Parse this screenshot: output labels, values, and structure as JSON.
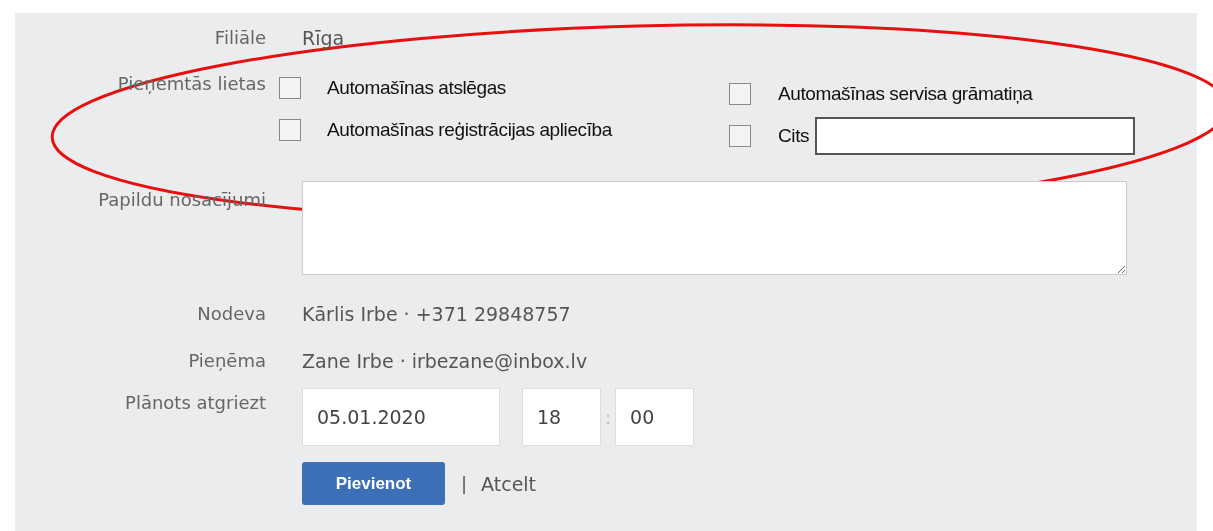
{
  "branch": {
    "label": "Filiāle",
    "value": "Rīga"
  },
  "accepted_items": {
    "label": "Pieņemtās lietas",
    "options": [
      {
        "kind": "checkbox",
        "label": "Automašīnas atslēgas",
        "checked": false
      },
      {
        "kind": "checkbox",
        "label": "Automašīnas servisa grāmatiņa",
        "checked": false
      },
      {
        "kind": "checkbox",
        "label": "Automašīnas reģistrācijas apliecība",
        "checked": false
      },
      {
        "kind": "checkbox-with-field",
        "label": "Cits",
        "checked": false
      }
    ]
  },
  "conditions": {
    "label": "Papildu nosacījumi"
  },
  "handed_over": {
    "label": "Nodeva",
    "value": "Kārlis Irbe · +371 29848757"
  },
  "received": {
    "label": "Pieņēma",
    "value": "Zane Irbe · irbezane@inbox.lv"
  },
  "planned_return": {
    "label": "Plānots atgriezt",
    "date": "05.01.2020",
    "hour": "18",
    "separator": ":",
    "minute": "00"
  },
  "actions": {
    "submit": "Pievienot",
    "separator": "|",
    "cancel": "Atcelt"
  }
}
